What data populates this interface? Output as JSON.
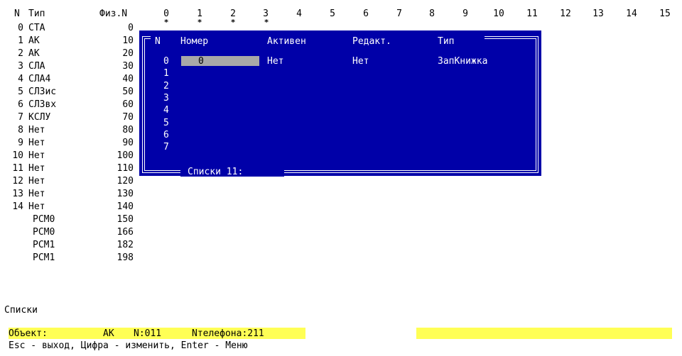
{
  "header": {
    "n_label": "N",
    "type_label": "Тип",
    "phys_label": "Физ.N",
    "columns": [
      "0",
      "1",
      "2",
      "3",
      "4",
      "5",
      "6",
      "7",
      "8",
      "9",
      "10",
      "11",
      "12",
      "13",
      "14",
      "15"
    ],
    "star": "*"
  },
  "rows": [
    {
      "n": "0",
      "type": "СТА",
      "phys": "0"
    },
    {
      "n": "1",
      "type": "АК",
      "phys": "10"
    },
    {
      "n": "2",
      "type": "АК",
      "phys": "20"
    },
    {
      "n": "3",
      "type": "СЛА",
      "phys": "30"
    },
    {
      "n": "4",
      "type": "СЛА4",
      "phys": "40"
    },
    {
      "n": "5",
      "type": "СЛЗис",
      "phys": "50"
    },
    {
      "n": "6",
      "type": "СЛЗвх",
      "phys": "60"
    },
    {
      "n": "7",
      "type": "КСЛУ",
      "phys": "70"
    },
    {
      "n": "8",
      "type": "Нет",
      "phys": "80"
    },
    {
      "n": "9",
      "type": "Нет",
      "phys": "90"
    },
    {
      "n": "10",
      "type": "Нет",
      "phys": "100"
    },
    {
      "n": "11",
      "type": "Нет",
      "phys": "110"
    },
    {
      "n": "12",
      "type": "Нет",
      "phys": "120"
    },
    {
      "n": "13",
      "type": "Нет",
      "phys": "130"
    },
    {
      "n": "14",
      "type": "Нет",
      "phys": "140"
    },
    {
      "n": "",
      "type": "РСМ0",
      "phys": "150"
    },
    {
      "n": "",
      "type": "РСМ0",
      "phys": "166"
    },
    {
      "n": "",
      "type": "РСМ1",
      "phys": "182"
    },
    {
      "n": "",
      "type": "РСМ1",
      "phys": "198"
    }
  ],
  "dialog": {
    "col_n": "N",
    "col_number": "Номер",
    "col_active": "Активен",
    "col_edit": "Редакт.",
    "col_type": "Тип",
    "row_indices": [
      "0",
      "1",
      "2",
      "3",
      "4",
      "5",
      "6",
      "7"
    ],
    "row0": {
      "number": "0",
      "active": "Нет",
      "edit": "Нет",
      "type": "ЗапКнижка"
    },
    "footer": "Списки 11:"
  },
  "section_label": "Списки",
  "status": {
    "object_label": "Объект:",
    "object_value": "АК",
    "n_value": "N:011",
    "phone_value": "Nтелефона:211"
  },
  "help_line": "Esc - выход, Цифра - изменить, Enter - Меню",
  "colors": {
    "dialog_bg": "#0000a8",
    "status_bg": "#ffff55",
    "field_bg": "#a8a8a8"
  }
}
